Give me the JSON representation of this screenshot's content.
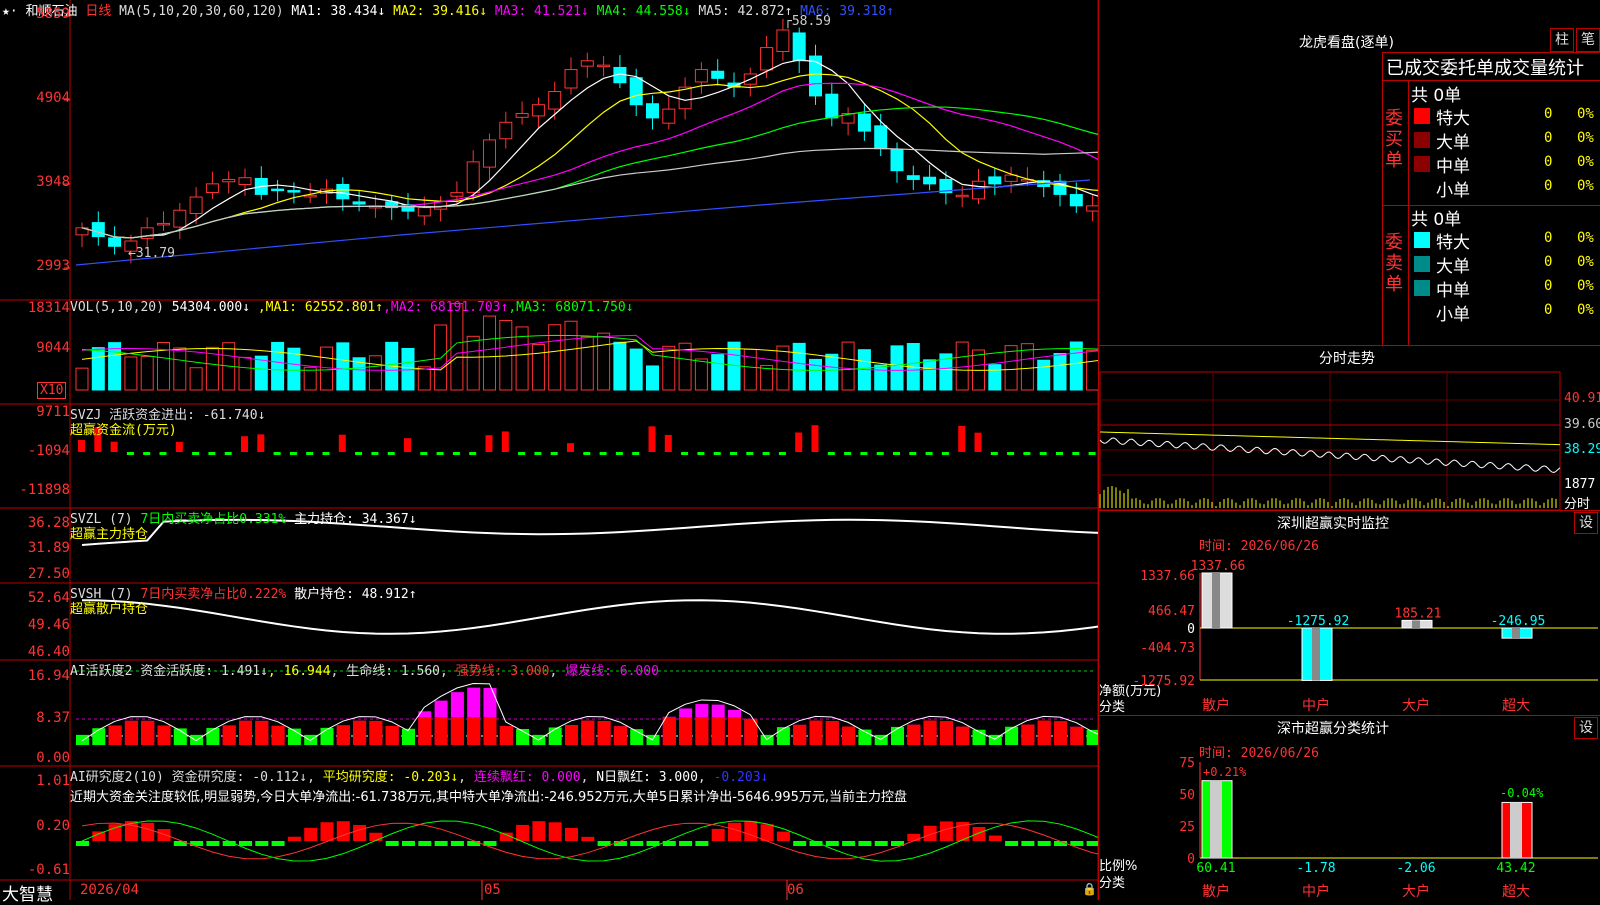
{
  "main": {
    "stock_name": "和顺石油",
    "period": "日线",
    "ma_title": "MA(5,10,20,30,60,120)",
    "ma_values": [
      {
        "label": "MA1: 38.434↓",
        "color": "#ffffff"
      },
      {
        "label": "MA2: 39.416↓",
        "color": "#ffff00"
      },
      {
        "label": "MA3: 41.521↓",
        "color": "#ff00ff"
      },
      {
        "label": "MA4: 44.558↓",
        "color": "#00ff00"
      },
      {
        "label": "MA5: 42.872↑",
        "color": "#dddddd"
      },
      {
        "label": "MA6: 39.318↑",
        "color": "#3050ff"
      }
    ],
    "y_labels": [
      "5859",
      "4904",
      "3948",
      "2993"
    ],
    "high_label": "58.59",
    "low_label": "31.79"
  },
  "vol": {
    "title": "VOL(5,10,20)",
    "value": "54304.000↓",
    "ma": [
      {
        "label": "MA1: 62552.801↑",
        "color": "#ffff00"
      },
      {
        "label": "MA2: 68191.703↑",
        "color": "#ff00ff"
      },
      {
        "label": "MA3: 68071.750↓",
        "color": "#00ff00"
      }
    ],
    "y_labels": [
      "18314",
      "9044"
    ],
    "unit": "X10"
  },
  "svzj": {
    "title": "SVZJ  活跃资金进出: -61.740↓",
    "subtitle": "超赢资金流(万元)",
    "y_labels": [
      "9711",
      "-1094",
      "-11898"
    ]
  },
  "svzl": {
    "title": "SVZL (7)",
    "t2": "7日内买卖净占比0.331%",
    "t3": "主力持仓: 34.367↓",
    "subtitle": "超赢主力持仓",
    "y_labels": [
      "36.28",
      "31.89",
      "27.50"
    ]
  },
  "svsh": {
    "title": "SVSH (7)",
    "t2": "7日内买卖净占比0.222%",
    "t3": "散户持仓: 48.912↑",
    "subtitle": "超赢散户持仓",
    "y_labels": [
      "52.64",
      "49.46",
      "46.40"
    ]
  },
  "ai1": {
    "title": "AI活跃度2 资金活跃度: 1.491↓",
    "v2": "16.944",
    "v3": "生命线: 1.560",
    "v4": "强势线: 3.000",
    "v5": "爆发线: 6.000",
    "y_labels": [
      "16.94",
      "8.37",
      "0.00"
    ]
  },
  "ai2": {
    "title": "AI研究度2(10) 资金研究度: -0.112↓",
    "v2": "平均研究度: -0.203↓",
    "v3": "连续飘红: 0.000",
    "v4": "N日飘红: 3.000",
    "v5": "-0.203↓",
    "note": "近期大资金关注度较低,明显弱势,今日大单净流出:-61.738万元,其中特大单净流出:-246.952万元,大单5日累计净出-5646.995万元,当前主力控盘",
    "y_labels": [
      "1.01",
      "0.20",
      "-0.61"
    ]
  },
  "bottom": {
    "brand": "大智慧",
    "dates": [
      "2026/04",
      "05",
      "06"
    ]
  },
  "dragon": {
    "title": "龙虎看盘(逐单)",
    "btn_zhu": "柱",
    "btn_bi": "笔",
    "header": "已成交委托单成交量统计",
    "buy_label": "委买单",
    "sell_label": "委卖单",
    "buy_total": "共 0单",
    "sell_total": "共 0单",
    "rows": [
      {
        "name": "特大",
        "v": "0",
        "p": "0%"
      },
      {
        "name": "大单",
        "v": "0",
        "p": "0%"
      },
      {
        "name": "中单",
        "v": "0",
        "p": "0%"
      },
      {
        "name": "小单",
        "v": "0",
        "p": "0%"
      }
    ],
    "buy_colors": [
      "#ff0000",
      "#8b0000",
      "#8b0000",
      "#000000"
    ],
    "sell_colors": [
      "#00ffff",
      "#008b8b",
      "#008b8b",
      "#000000"
    ]
  },
  "fenshi": {
    "title": "分时走势",
    "prices": [
      "40.91",
      "39.60",
      "38.29"
    ],
    "vol_label": "1877",
    "vol_unit": "分时"
  },
  "monitor": {
    "title": "深圳超赢实时监控",
    "btn": "设",
    "time": "时间: 2026/06/26",
    "y_labels": [
      "1337.66",
      "466.47",
      "0",
      "-404.73",
      "-1275.92"
    ],
    "unit_label": "净额(万元)",
    "cat_label": "分类",
    "categories": [
      "散户",
      "中户",
      "大户",
      "超大"
    ],
    "values": [
      1337.66,
      -1275.92,
      185.21,
      -246.95
    ],
    "value_labels": [
      "1337.66",
      "-1275.92",
      "185.21",
      "-246.95"
    ]
  },
  "classify": {
    "title": "深市超赢分类统计",
    "btn": "设",
    "time": "时间: 2026/06/26",
    "y_labels": [
      "75",
      "50",
      "25",
      "0"
    ],
    "unit_label": "比例%",
    "cat_label": "分类",
    "categories": [
      "散户",
      "中户",
      "大户",
      "超大"
    ],
    "values": [
      60.41,
      -1.78,
      -2.06,
      43.42
    ],
    "value_labels": [
      "60.41",
      "-1.78",
      "-2.06",
      "43.42"
    ],
    "top_labels": [
      "+0.21%",
      "-0.04%"
    ]
  },
  "chart_data": [
    {
      "type": "candlestick",
      "title": "和顺石油 日线",
      "ylim": [
        29.93,
        58.59
      ],
      "close_approx": [
        34.5,
        33.5,
        32.4,
        33.0,
        34.5,
        35.0,
        36.5,
        38.0,
        39.5,
        40.0,
        40.2,
        38.3,
        38.8,
        38.6,
        38.2,
        38.9,
        37.8,
        37.2,
        37.0,
        36.8,
        36.4,
        36.8,
        37.5,
        38.5,
        42.0,
        44.5,
        46.5,
        47.5,
        48.5,
        50.0,
        52.5,
        53.5,
        53.0,
        51.0,
        48.5,
        47.0,
        48.0,
        50.5,
        52.5,
        51.5,
        50.5,
        52.0,
        55.0,
        57.0,
        53.5,
        49.5,
        47.0,
        47.5,
        45.5,
        43.5,
        41.0,
        40.0,
        39.5,
        38.5,
        38.2,
        39.8,
        39.5,
        40.5,
        40.0,
        39.2,
        38.3,
        37.0,
        37.0,
        37.2
      ],
      "annotations": [
        "58.59",
        "31.79"
      ]
    },
    {
      "type": "bar",
      "title": "VOL(5,10,20)",
      "ylim": [
        0,
        18314
      ],
      "note": "volume in X10"
    }
  ]
}
